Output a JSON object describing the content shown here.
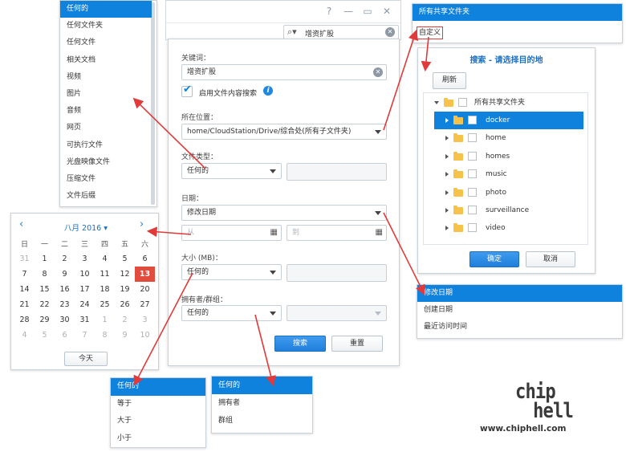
{
  "search_window": {
    "help_icon": "?",
    "search_value": "增资扩股"
  },
  "search_panel": {
    "keyword_label": "关键词：",
    "keyword_value": "增资扩股",
    "content_search_label": "启用文件内容搜索",
    "location_label": "所在位置：",
    "location_value": "home/CloudStation/Drive/综合处(所有子文件夹)",
    "filetype_label": "文件类型：",
    "filetype_value": "任何的",
    "date_label": "日期：",
    "date_value": "修改日期",
    "from_placeholder": "从",
    "to_placeholder": "到",
    "size_label": "大小 (MB)：",
    "size_value": "任何的",
    "owner_label": "拥有者/群组：",
    "owner_value": "任何的",
    "search_button": "搜索",
    "reset_button": "重置"
  },
  "filetype_menu": [
    "任何的",
    "任何文件夹",
    "任何文件",
    "相关文档",
    "视频",
    "图片",
    "音频",
    "网页",
    "可执行文件",
    "光盘映像文件",
    "压缩文件",
    "文件后缀"
  ],
  "location_menu": [
    "所有共享文件夹",
    "自定义"
  ],
  "destination_dialog": {
    "title": "搜索 - 请选择目的地",
    "refresh_button": "刷新",
    "root": "所有共享文件夹",
    "folders": [
      "docker",
      "home",
      "homes",
      "music",
      "photo",
      "surveillance",
      "video"
    ],
    "ok_button": "确定",
    "cancel_button": "取消"
  },
  "date_menu": [
    "修改日期",
    "创建日期",
    "最近访问时间"
  ],
  "calendar": {
    "month_label": "八月 2016",
    "weekdays": [
      "日",
      "一",
      "二",
      "三",
      "四",
      "五",
      "六"
    ],
    "weeks": [
      [
        "31",
        "1",
        "2",
        "3",
        "4",
        "5",
        "6"
      ],
      [
        "7",
        "8",
        "9",
        "10",
        "11",
        "12",
        "13"
      ],
      [
        "14",
        "15",
        "16",
        "17",
        "18",
        "19",
        "20"
      ],
      [
        "21",
        "22",
        "23",
        "24",
        "25",
        "26",
        "27"
      ],
      [
        "28",
        "29",
        "30",
        "31",
        "1",
        "2",
        "3"
      ],
      [
        "4",
        "5",
        "6",
        "7",
        "8",
        "9",
        "10"
      ]
    ],
    "today_button": "今天"
  },
  "size_menu": [
    "任何的",
    "等于",
    "大于",
    "小于"
  ],
  "owner_menu": [
    "任何的",
    "拥有者",
    "群组"
  ],
  "watermark": {
    "site": "www.chiphell.com",
    "logo_top": "chip",
    "logo_bottom": "hell"
  },
  "colors": {
    "accent": "#0e82dc",
    "arrow": "#e03a3a",
    "today": "#e24c3f"
  }
}
